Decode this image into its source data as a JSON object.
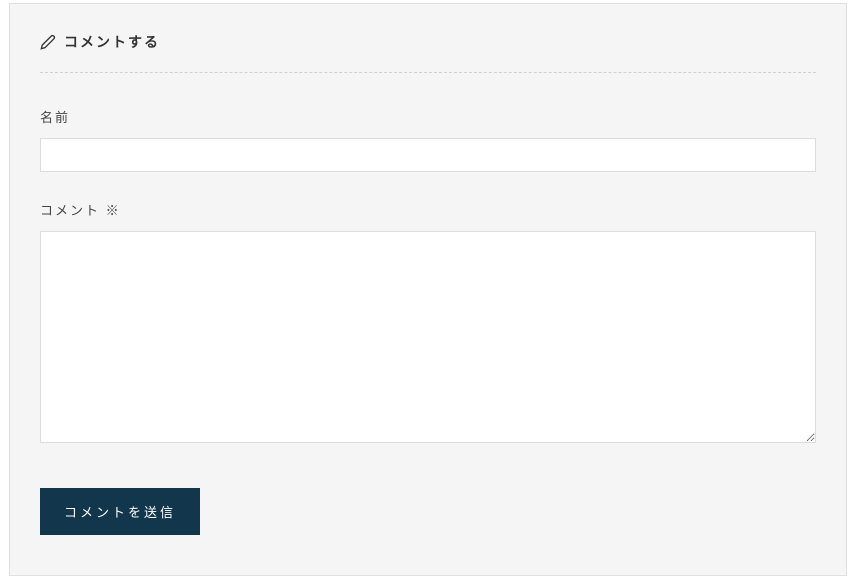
{
  "form": {
    "heading": "コメントする",
    "name_label": "名前",
    "name_value": "",
    "comment_label": "コメント ※",
    "comment_value": "",
    "submit_label": "コメントを送信"
  }
}
